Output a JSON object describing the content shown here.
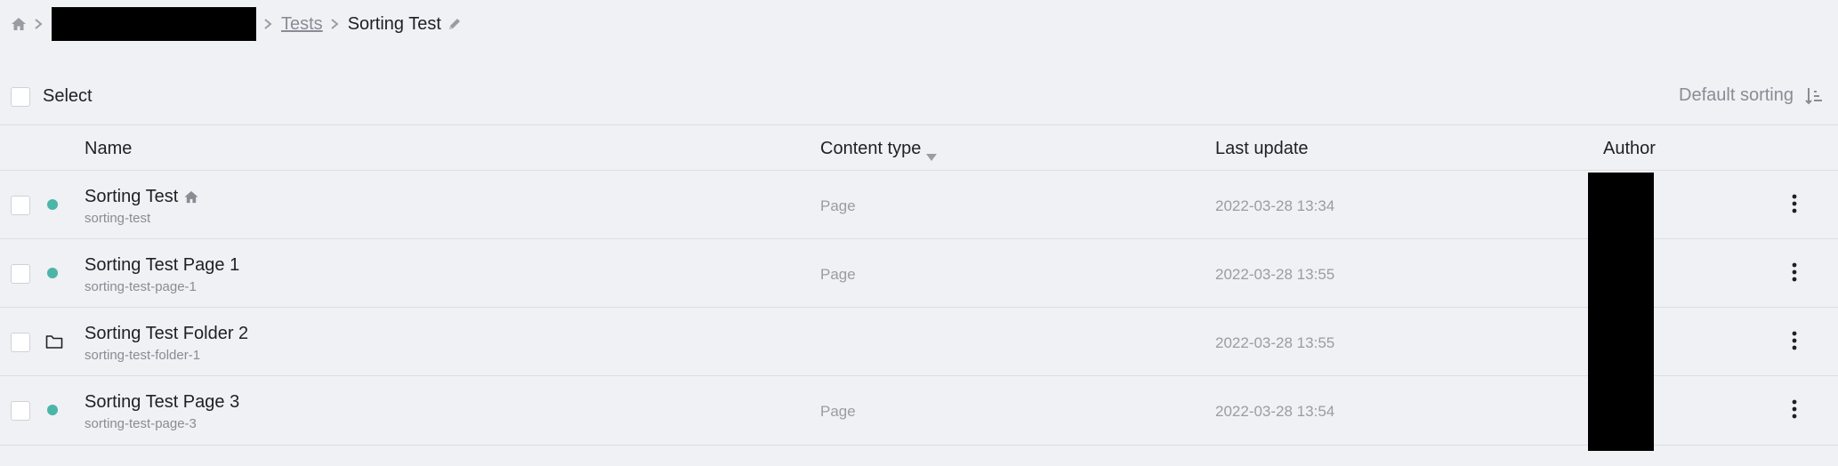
{
  "breadcrumb": {
    "home_icon": "home-icon",
    "link": "Tests",
    "current": "Sorting Test",
    "edit_icon": "pencil-icon"
  },
  "toolbar": {
    "select_label": "Select",
    "sort_label": "Default sorting",
    "sort_icon": "sort-ascending-icon"
  },
  "table": {
    "columns": {
      "name": "Name",
      "content_type": "Content type",
      "last_update": "Last update",
      "author": "Author"
    },
    "rows": [
      {
        "title": "Sorting Test",
        "slug": "sorting-test",
        "type": "Page",
        "updated": "2022-03-28 13:34",
        "icon": "status-dot",
        "home": true
      },
      {
        "title": "Sorting Test Page 1",
        "slug": "sorting-test-page-1",
        "type": "Page",
        "updated": "2022-03-28 13:55",
        "icon": "status-dot"
      },
      {
        "title": "Sorting Test Folder 2",
        "slug": "sorting-test-folder-1",
        "type": "",
        "updated": "2022-03-28 13:55",
        "icon": "folder-icon"
      },
      {
        "title": "Sorting Test Page 3",
        "slug": "sorting-test-page-3",
        "type": "Page",
        "updated": "2022-03-28 13:54",
        "icon": "status-dot"
      }
    ]
  },
  "colors": {
    "status_published": "#4bb5a8",
    "background": "#f0f1f5",
    "muted_text": "#8a8c94"
  }
}
